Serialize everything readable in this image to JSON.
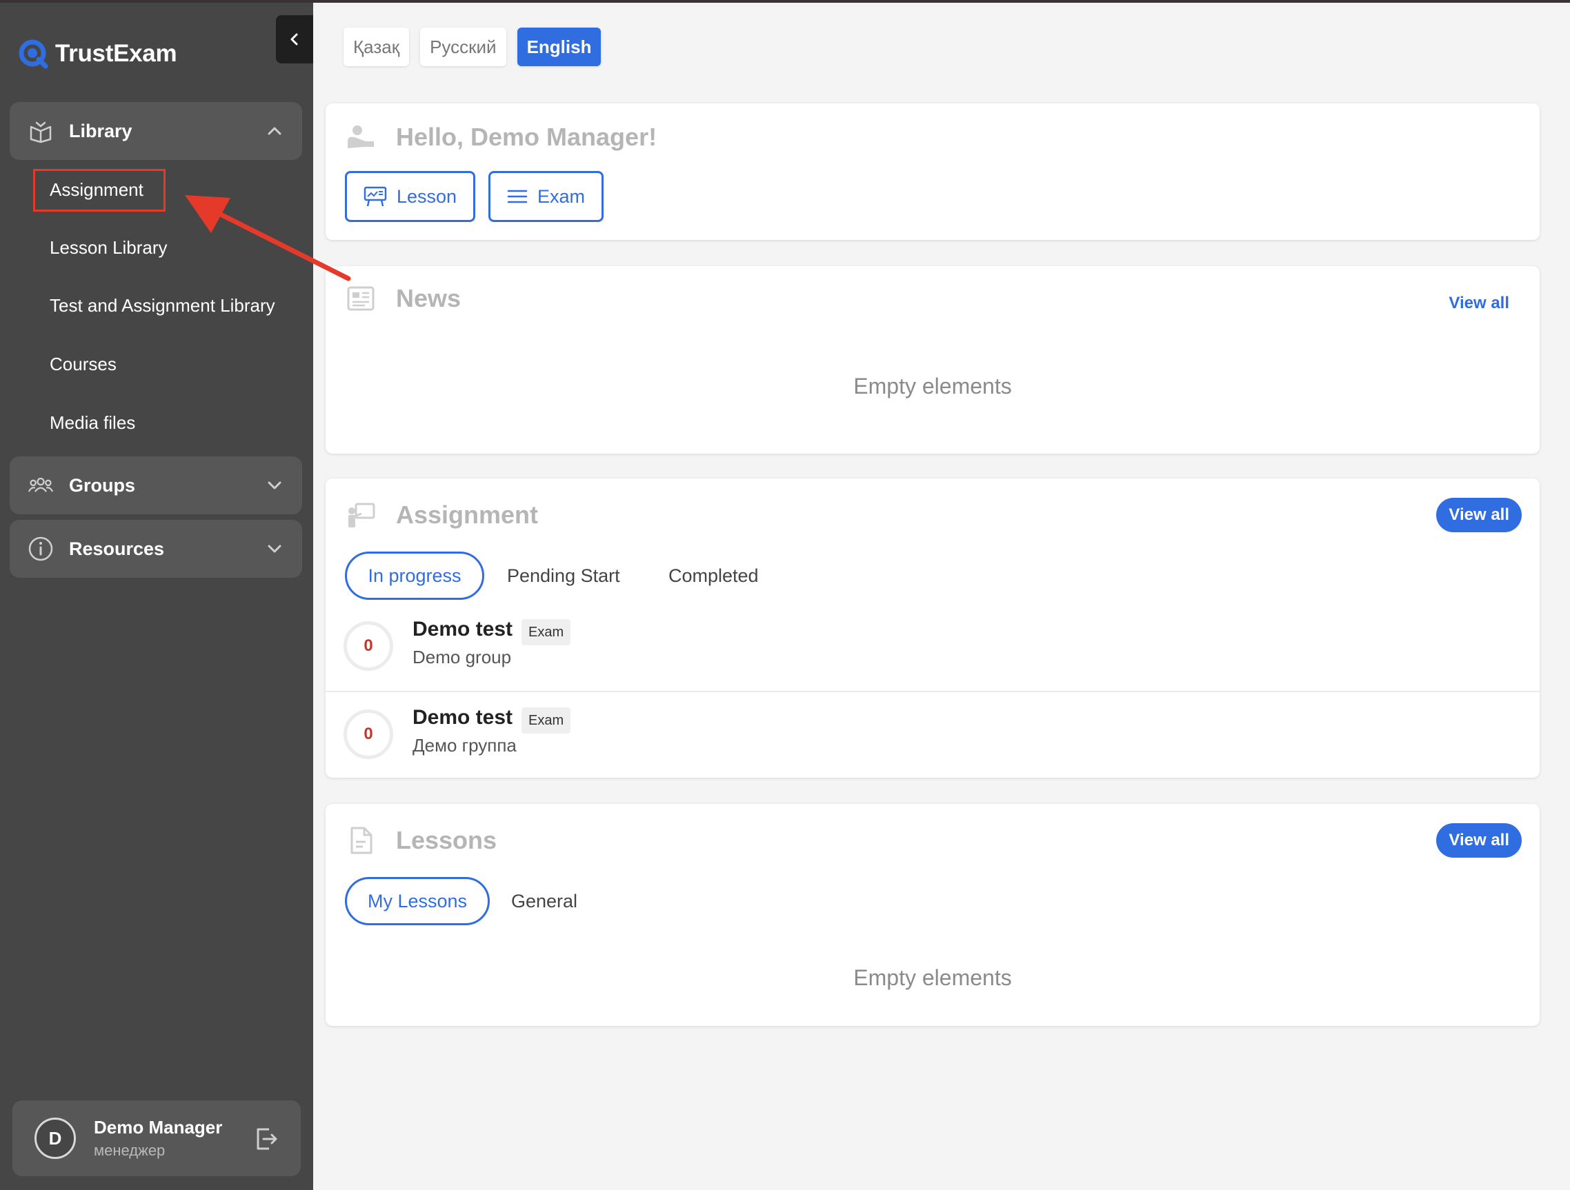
{
  "app": {
    "name": "TrustExam"
  },
  "sidebar": {
    "groups": [
      {
        "label": "Library",
        "icon": "book-open-icon",
        "expanded": true,
        "items": [
          {
            "label": "Assignment",
            "highlighted": true
          },
          {
            "label": "Lesson Library"
          },
          {
            "label": "Test and Assignment Library"
          },
          {
            "label": "Courses"
          },
          {
            "label": "Media files"
          }
        ]
      },
      {
        "label": "Groups",
        "icon": "users-icon",
        "expanded": false
      },
      {
        "label": "Resources",
        "icon": "info-icon",
        "expanded": false
      }
    ],
    "user": {
      "initial": "D",
      "name": "Demo Manager",
      "role": "менеджер"
    }
  },
  "languages": [
    {
      "label": "Қазақ",
      "active": false
    },
    {
      "label": "Русский",
      "active": false
    },
    {
      "label": "English",
      "active": true
    }
  ],
  "greeting": {
    "title": "Hello, Demo Manager!",
    "buttons": [
      {
        "label": "Lesson",
        "icon": "presentation-icon"
      },
      {
        "label": "Exam",
        "icon": "menu-lines-icon"
      }
    ]
  },
  "news": {
    "title": "News",
    "view_all": "View all",
    "empty": "Empty elements"
  },
  "assignment": {
    "title": "Assignment",
    "view_all": "View all",
    "tabs": [
      {
        "label": "In progress",
        "active": true
      },
      {
        "label": "Pending Start"
      },
      {
        "label": "Completed"
      }
    ],
    "items": [
      {
        "score": "0",
        "title": "Demo test",
        "badge": "Exam",
        "group": "Demo group"
      },
      {
        "score": "0",
        "title": "Demo test",
        "badge": "Exam",
        "group": "Демо группа"
      }
    ]
  },
  "lessons": {
    "title": "Lessons",
    "view_all": "View all",
    "tabs": [
      {
        "label": "My Lessons",
        "active": true
      },
      {
        "label": "General"
      }
    ],
    "empty": "Empty elements"
  },
  "colors": {
    "sidebar_bg": "#464646",
    "accent": "#2f6de0",
    "annotation": "#e53a2a",
    "score": "#c0392b"
  }
}
